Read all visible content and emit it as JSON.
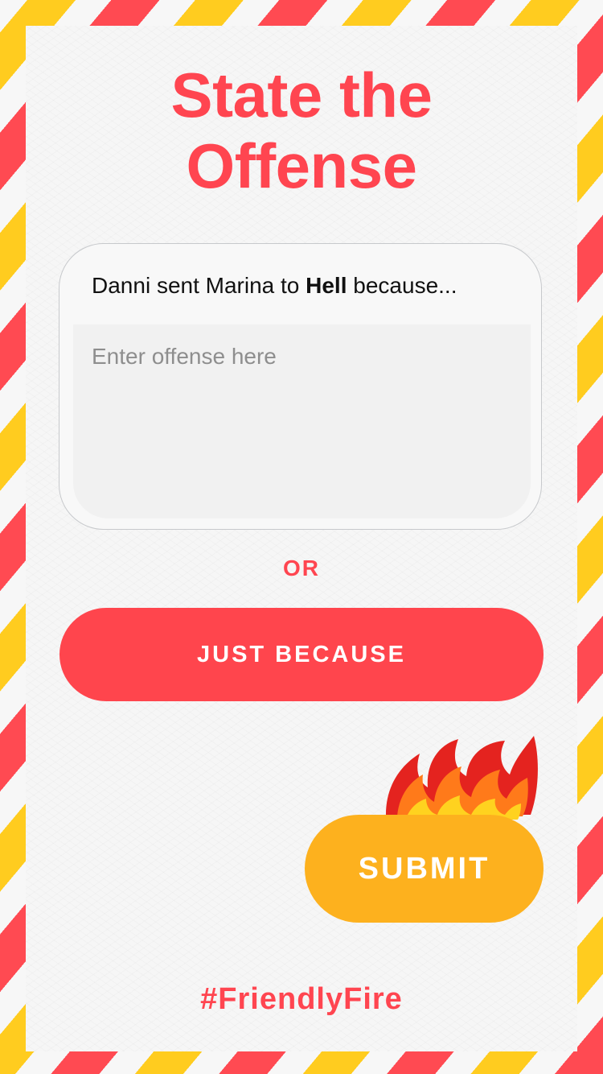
{
  "page": {
    "title_line1": "State the",
    "title_line2": "Offense"
  },
  "card": {
    "prompt_before": "Danni sent Marina to ",
    "prompt_bold": "Hell",
    "prompt_after": " because...",
    "input_value": "",
    "input_placeholder": "Enter offense here"
  },
  "separator": {
    "label": "OR"
  },
  "buttons": {
    "just_because": "JUST BECAUSE",
    "submit": "SUBMIT"
  },
  "footer": {
    "hashtag": "#FriendlyFire"
  },
  "decor": {
    "flame_icon": "flame-icon"
  },
  "colors": {
    "accent_red": "#ff454d",
    "accent_yellow": "#ffcc1f",
    "submit_orange": "#fdb11e"
  }
}
